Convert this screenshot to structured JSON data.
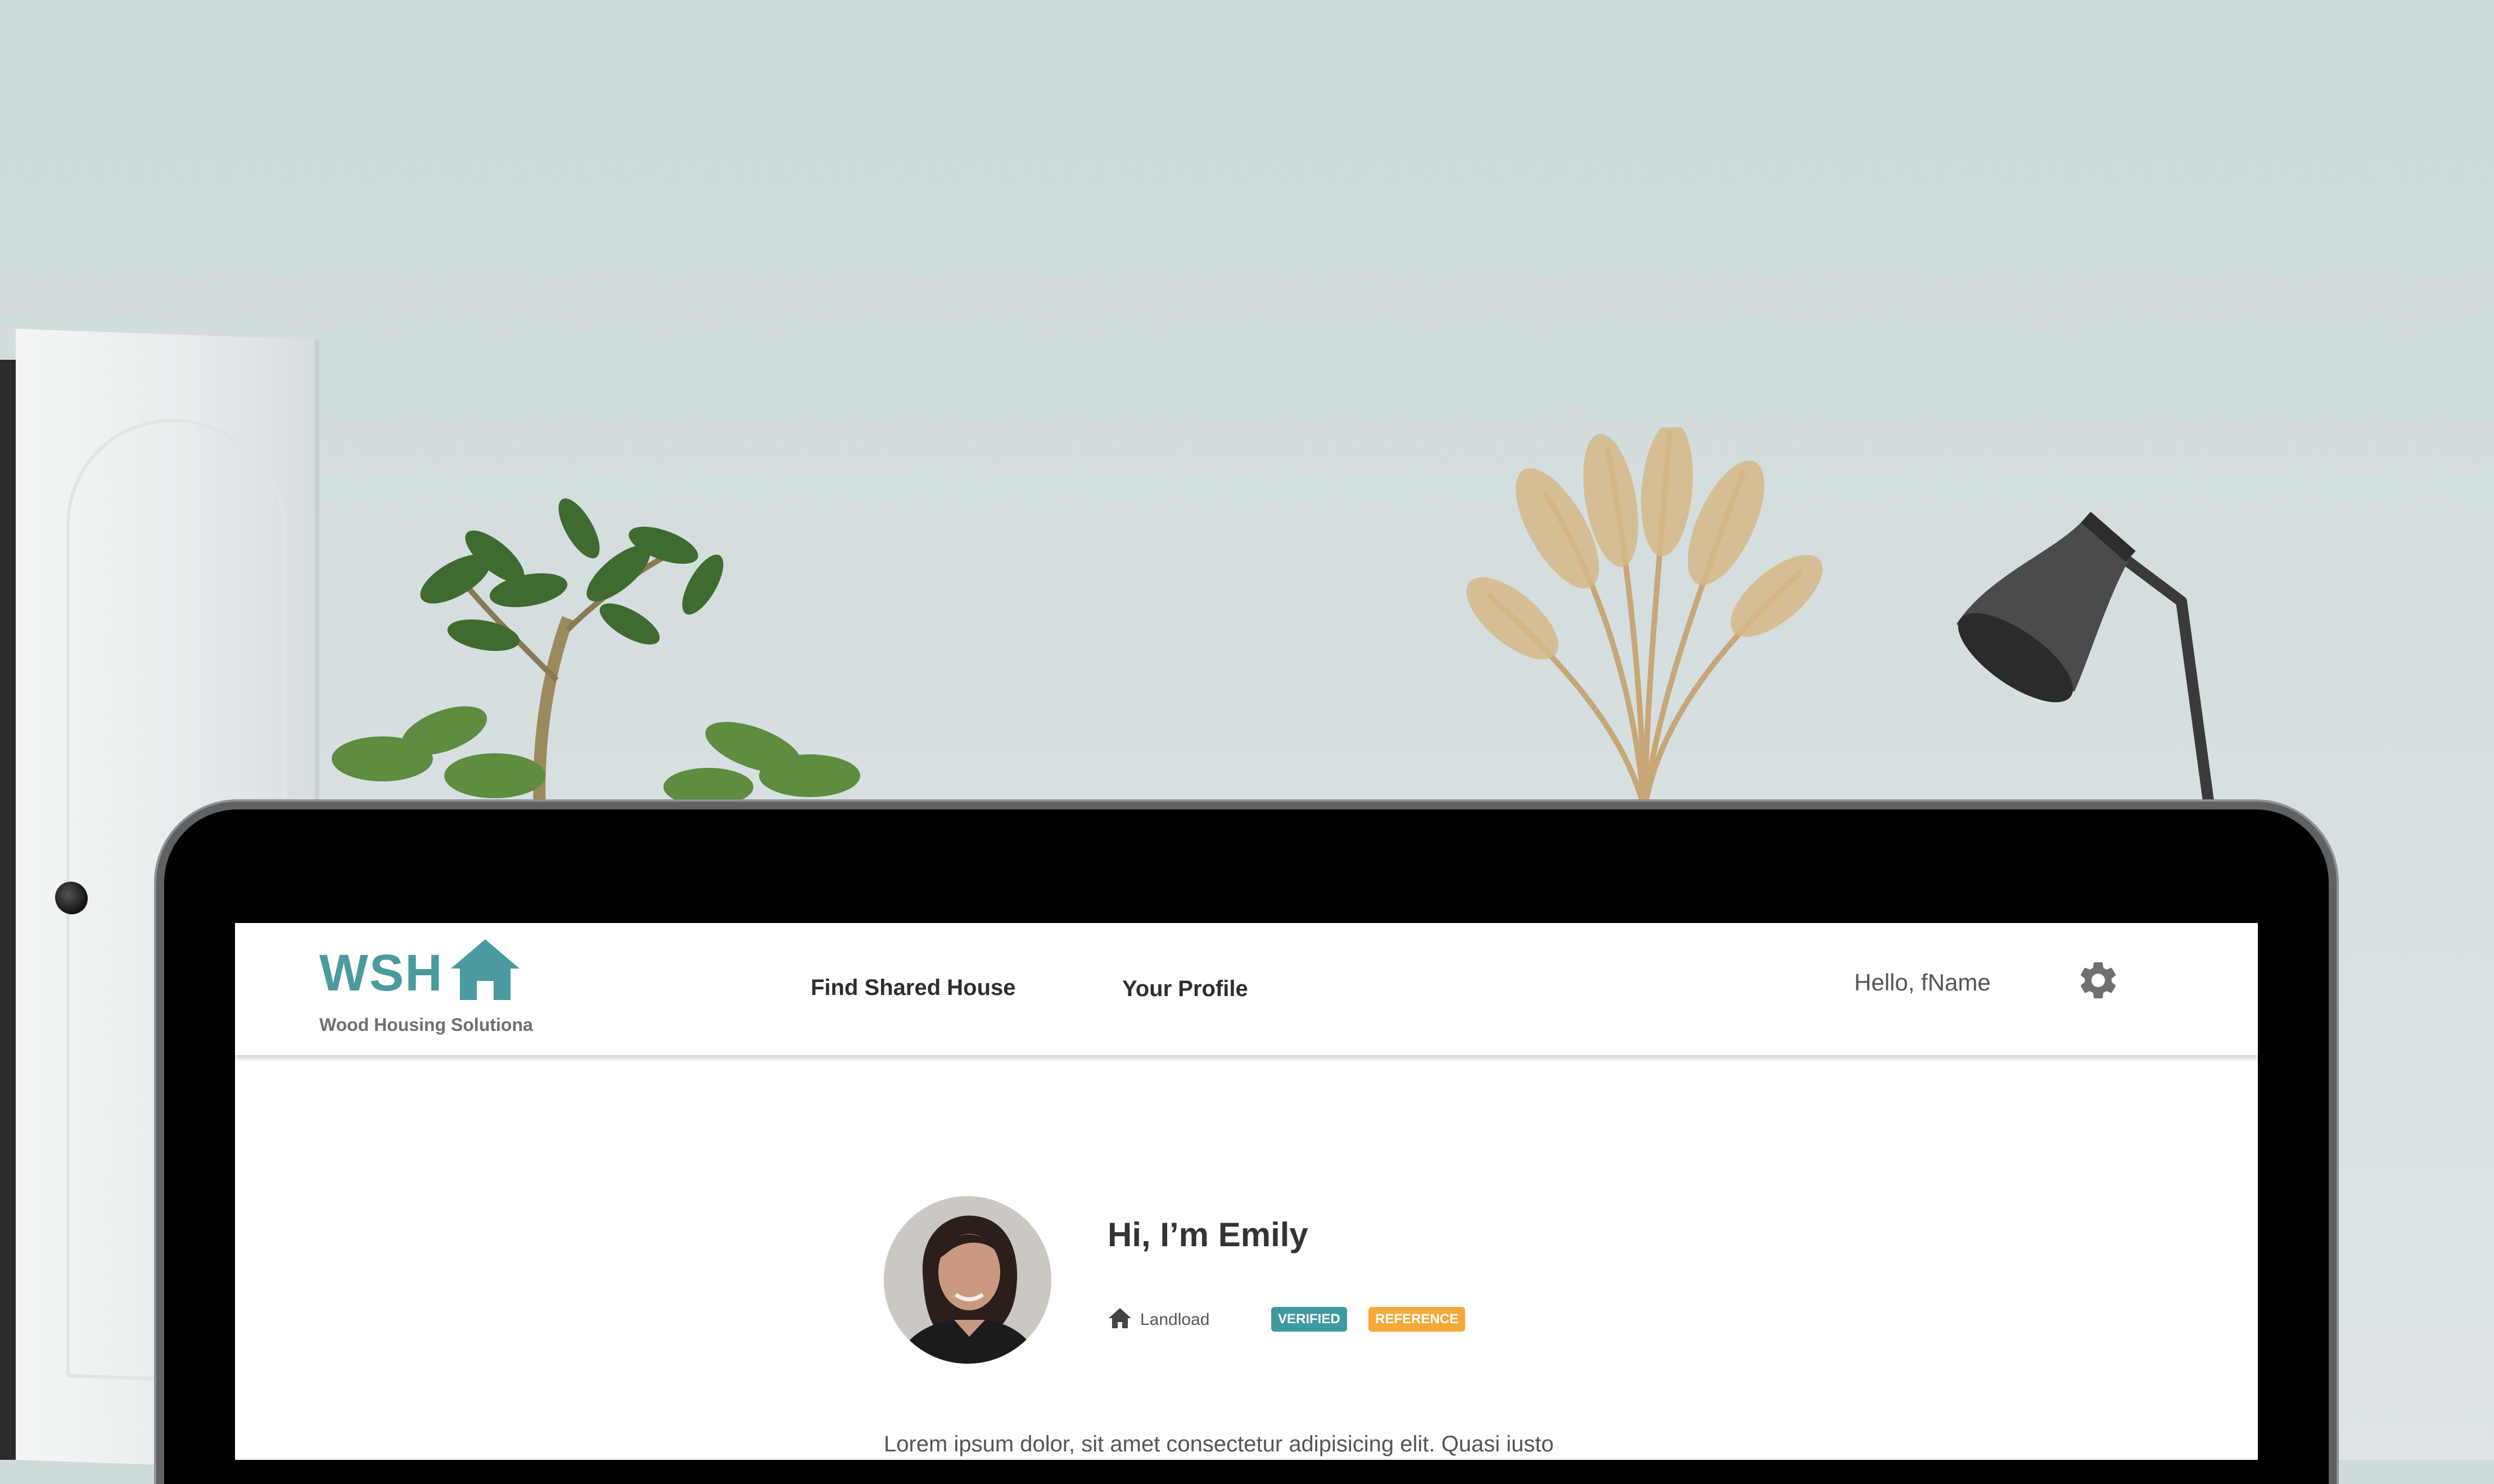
{
  "navbar": {
    "logo": {
      "acronym": "WSH",
      "subtitle": "Wood Housing Solutiona",
      "icon": "house-icon"
    },
    "links": [
      {
        "label": "Find Shared House"
      },
      {
        "label": "Your Profile"
      }
    ],
    "greeting": "Hello, fName",
    "settings_icon": "gear-icon"
  },
  "profile": {
    "title": "Hi, I’m Emily",
    "role": {
      "icon": "house-icon",
      "label": "Landload"
    },
    "badges": [
      {
        "label": "VERIFIED",
        "color": "#3f9aa0"
      },
      {
        "label": "REFERENCE",
        "color": "#f5a93a"
      }
    ],
    "bio": "Lorem ipsum dolor, sit amet consectetur adipisicing elit. Quasi iusto reprehenderit qui. Ex quibusdam nam aliquid impedit corporis veritatis"
  },
  "colors": {
    "brand_teal": "#4a9aa0",
    "badge_orange": "#f5a93a",
    "laptop_bezel": "#000000"
  }
}
